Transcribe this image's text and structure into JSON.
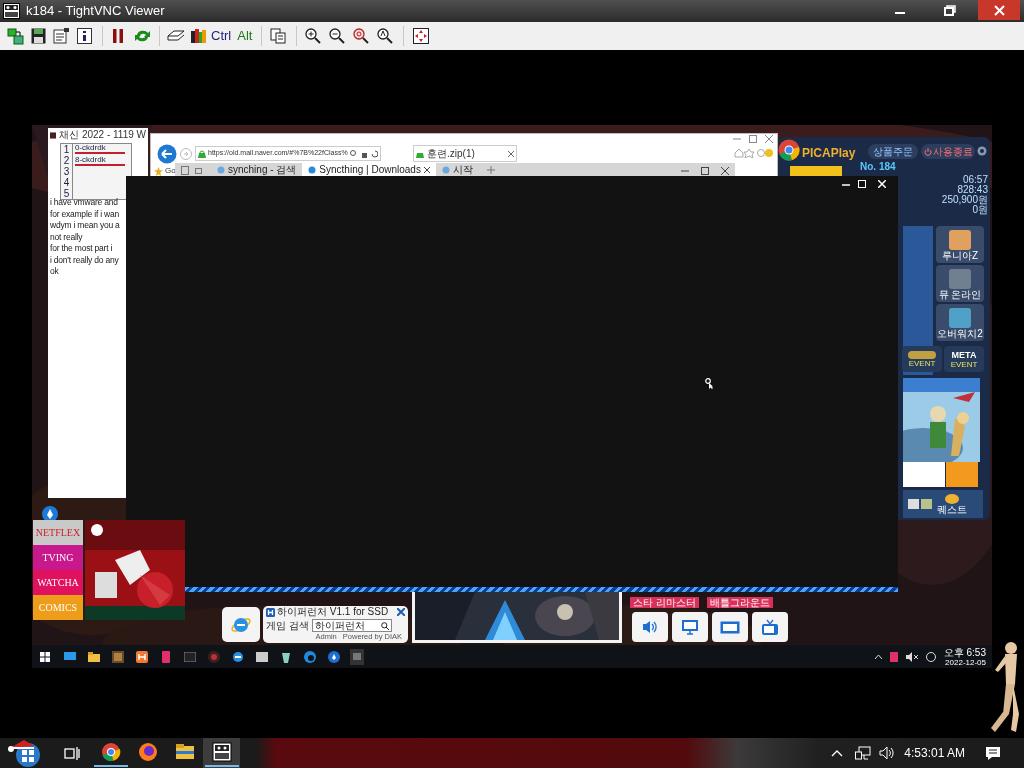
{
  "window": {
    "title": "k184 - TightVNC Viewer"
  },
  "toolbar": {
    "keys": [
      "Ctrl",
      "Alt"
    ]
  },
  "remote": {
    "chat_window": {
      "title": "채신 2022 - 1119 W",
      "grid": {
        "row_numbers": [
          "1",
          "2",
          "3",
          "4",
          "5"
        ],
        "cells": [
          "0-ckdrdk",
          "8-ckdrdk"
        ]
      },
      "lines": [
        "i have vmware and",
        "for example if i wan",
        "wdym i mean you a",
        "not really",
        "for the most part i",
        "i don't really do any",
        "ok"
      ]
    },
    "browser": {
      "url": "https://old.mail.naver.com/#%7B%22fClass%",
      "tab": "훈련.zip(1)",
      "favorite": "Go"
    },
    "browser_tabs": [
      {
        "label": "synching - 검색",
        "selected": false
      },
      {
        "label": "Syncthing | Downloads",
        "selected": true
      },
      {
        "label": "시작",
        "selected": false
      }
    ],
    "picaplay": {
      "logo": "PICAPlay",
      "buttons": [
        "상품주문",
        "사용종료"
      ],
      "seat": "No. 184",
      "readings": [
        "06:57",
        "828:43",
        "250,900원",
        "0원"
      ],
      "games": [
        "루니아Z",
        "뮤 온라인",
        "오버워치2"
      ],
      "events": [
        {
          "label": "EVENT"
        },
        {
          "title": "META",
          "label": "EVENT"
        }
      ],
      "quest": "퀘스트"
    },
    "streaming_tiles": [
      {
        "label": "NETFLEX",
        "color": "#c9c9c9"
      },
      {
        "label": "TVING",
        "color": "#c8198c"
      },
      {
        "label": "WATCHA",
        "color": "#e0115f"
      },
      {
        "label": "COMICS",
        "color": "#ee9d1a"
      }
    ],
    "launcher": {
      "title": "하이퍼런처 V1.1 for SSD",
      "search_label": "게임 검색",
      "search_value": "하이퍼런처",
      "footer": [
        "Admin",
        "Powered by DIAK"
      ]
    },
    "game_labels": [
      "스타 리마스터",
      "배틀그라운드"
    ],
    "taskbar": {
      "time": "오후 6:53",
      "date": "2022-12-05"
    }
  },
  "taskbar": {
    "time": "4:53:01 AM",
    "apps": [
      {
        "running": true,
        "selected": false
      },
      {
        "running": false,
        "selected": false
      },
      {
        "running": false,
        "selected": false
      },
      {
        "running": true,
        "selected": true
      }
    ]
  }
}
